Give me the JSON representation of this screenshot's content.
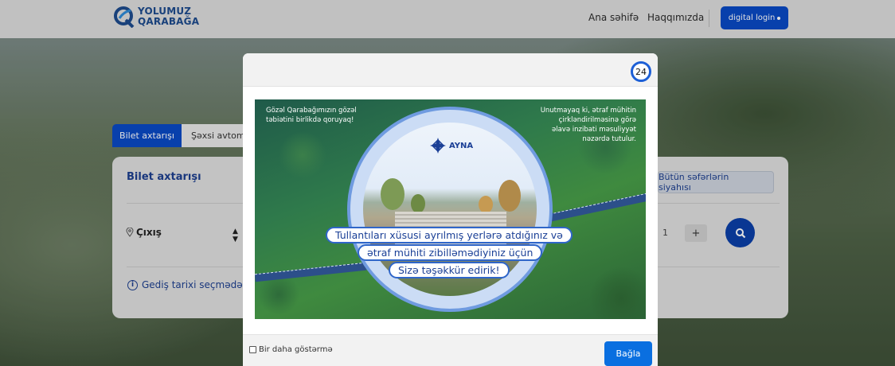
{
  "header": {
    "logo_line1": "YOLUMUZ",
    "logo_line2": "QARABAĞA",
    "nav": [
      {
        "label": "Ana səhifə"
      },
      {
        "label": "Haqqımızda"
      }
    ],
    "login_label": "digital login"
  },
  "search": {
    "tabs": [
      {
        "label": "Bilet axtarışı",
        "active": true
      },
      {
        "label": "Şəxsi avtomo"
      }
    ],
    "card_title": "Bilet axtarışı",
    "all_trips_label": "Bütün səfərlərin siyahısı",
    "origin_label": "Çıxış",
    "passenger_count": "1",
    "plus_label": "+",
    "date_info": "Gediş tarixi seçmədə"
  },
  "modal": {
    "timer": "24",
    "banner": {
      "text_left": [
        "Gözəl Qarabağımızın gözəl",
        "təbiətini birlikdə qoruyaq!"
      ],
      "text_right": [
        "Unutmayaq ki, ətraf mühitin",
        "çirkləndirilməsinə görə",
        "əlavə inzibati məsuliyyət",
        "nəzərdə tutulur."
      ],
      "brand": "AYNA",
      "messages": [
        "Tullantıları xüsusi ayrılmış yerlərə atdığınız və",
        "ətraf mühiti zibilləmədiyiniz üçün",
        "Sizə təşəkkür edirik!"
      ]
    },
    "dont_show_label": "Bir daha göstərmə",
    "close_label": "Bağla"
  },
  "colors": {
    "brand_blue": "#0a49c4",
    "title_blue": "#1d3f8f",
    "modal_button": "#0a6fe0"
  }
}
